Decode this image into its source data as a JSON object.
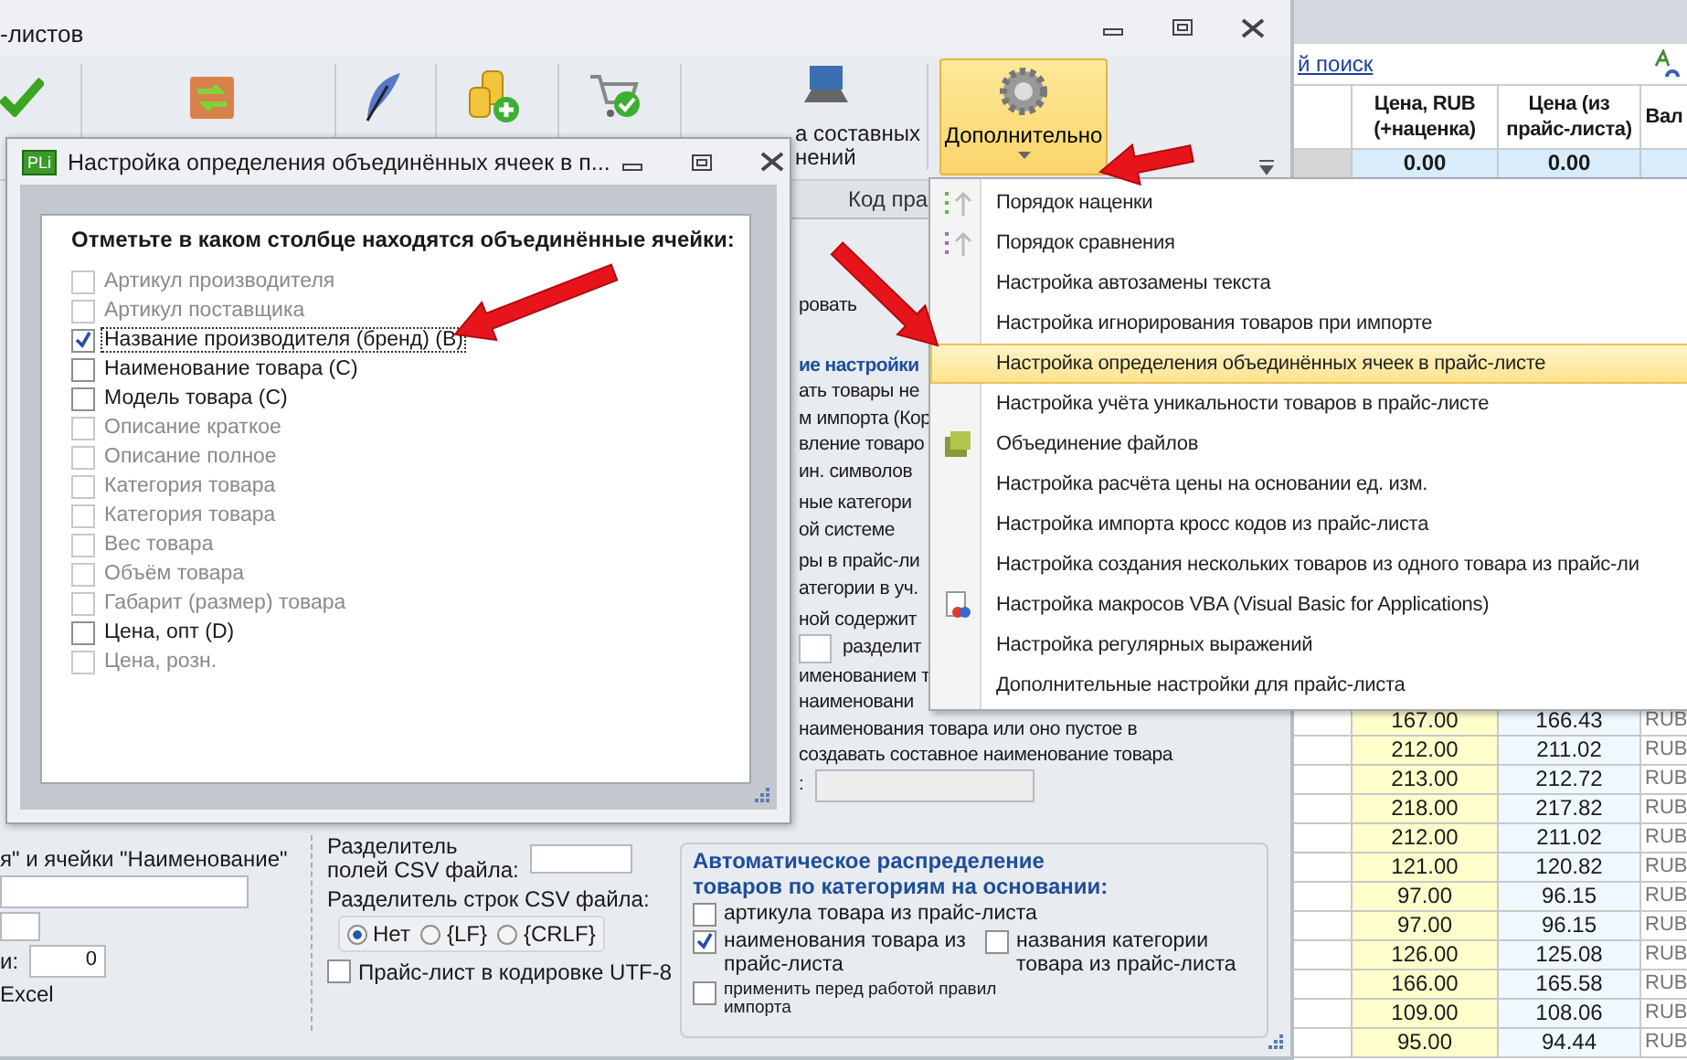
{
  "main_window": {
    "title": "-листов",
    "toolbar": {
      "laptop_label": [
        "а составных",
        "нений"
      ],
      "more_button": {
        "label": "Дополнительно",
        "selected": true
      }
    },
    "column_header": "Код пра",
    "fragments": [
      {
        "kind": "text",
        "text": "ровать"
      },
      {
        "kind": "heading",
        "text": "ие настройки"
      },
      {
        "kind": "text",
        "text": "ать товары не"
      },
      {
        "kind": "text",
        "text": "м импорта (Кор"
      },
      {
        "kind": "text",
        "text": "вление товаро"
      },
      {
        "kind": "text",
        "text": "ин. символов"
      },
      {
        "kind": "gap-text",
        "text": "ные категори"
      },
      {
        "kind": "text",
        "text": "ой системе"
      },
      {
        "kind": "gap-text",
        "text": "ры в прайс-ли"
      },
      {
        "kind": "text",
        "text": "атегории в уч."
      },
      {
        "kind": "gap-text",
        "text": "ной содержит"
      },
      {
        "kind": "field-text",
        "text": "разделит"
      },
      {
        "kind": "text",
        "text": "именованием т"
      },
      {
        "kind": "text",
        "text": "наименовани"
      },
      {
        "kind": "text",
        "text": "наименования товара или оно пустое в"
      },
      {
        "kind": "text",
        "text": "создавать составное наименование товара"
      },
      {
        "kind": "text-field",
        "text": ":"
      }
    ],
    "bottom_left": {
      "caption": "я\" и ячейки \"Наименование\"",
      "count_label": "и:",
      "count_value": "0",
      "excel_label": "Excel"
    },
    "csv": {
      "field_separator_label": [
        "Разделитель",
        "полей CSV файла:"
      ],
      "row_separator_label": "Разделитель строк CSV файла:",
      "radios": [
        {
          "label": "Нет",
          "selected": true
        },
        {
          "label": "{LF}",
          "selected": false
        },
        {
          "label": "{CRLF}",
          "selected": false
        }
      ],
      "utf8": {
        "label": "Прайс-лист в кодировке UTF-8",
        "checked": false
      }
    },
    "category_group": {
      "title": [
        "Автоматическое распределение",
        "товаров по категориям на основании:"
      ],
      "options": [
        {
          "kind": "wide",
          "label": "артикула товара из прайс-листа",
          "checked": false
        },
        {
          "kind": "half",
          "label": "наименования товара из прайс-листа",
          "checked": true
        },
        {
          "kind": "half",
          "label": "названия  категории товара из прайс-листа",
          "checked": false
        },
        {
          "kind": "small",
          "label": "применить перед работой правил импорта",
          "checked": false
        }
      ]
    }
  },
  "grid": {
    "search_link": "й поиск",
    "columns": [
      "Цена, RUB (+наценка)",
      "Цена (из прайс-листа)",
      "Вал"
    ],
    "first_row": [
      "0.00",
      "0.00"
    ],
    "rows": [
      [
        "167.00",
        "166.43",
        "RUB"
      ],
      [
        "212.00",
        "211.02",
        "RUB"
      ],
      [
        "213.00",
        "212.72",
        "RUB"
      ],
      [
        "218.00",
        "217.82",
        "RUB"
      ],
      [
        "212.00",
        "211.02",
        "RUB"
      ],
      [
        "121.00",
        "120.82",
        "RUB"
      ],
      [
        "97.00",
        "96.15",
        "RUB"
      ],
      [
        "97.00",
        "96.15",
        "RUB"
      ],
      [
        "126.00",
        "125.08",
        "RUB"
      ],
      [
        "166.00",
        "165.58",
        "RUB"
      ],
      [
        "109.00",
        "108.06",
        "RUB"
      ],
      [
        "95.00",
        "94.44",
        "RUB"
      ]
    ]
  },
  "menu": {
    "items": [
      {
        "kind": "ranking",
        "label": "Порядок наценки",
        "selected": false
      },
      {
        "kind": "comparison",
        "label": "Порядок сравнения",
        "selected": false
      },
      {
        "kind": "plain",
        "label": "Настройка автозамены текста",
        "selected": false
      },
      {
        "kind": "plain",
        "label": "Настройка игнорирования товаров при импорте",
        "selected": false
      },
      {
        "kind": "plain",
        "label": "Настройка определения объединённых ячеек в прайс-листе",
        "selected": true
      },
      {
        "kind": "plain",
        "label": "Настройка учёта уникальности товаров в прайс-листе",
        "selected": false
      },
      {
        "kind": "files",
        "label": "Объединение файлов",
        "selected": false
      },
      {
        "kind": "plain",
        "label": "Настройка расчёта цены на основании ед. изм.",
        "selected": false
      },
      {
        "kind": "plain",
        "label": "Настройка импорта кросс кодов из прайс-листа",
        "selected": false
      },
      {
        "kind": "plain",
        "label": "Настройка создания нескольких товаров из одного товара из прайс-ли",
        "selected": false
      },
      {
        "kind": "macro",
        "label": "Настройка макросов VBA (Visual Basic for Applications)",
        "selected": false
      },
      {
        "kind": "plain",
        "label": "Настройка регулярных выражений",
        "selected": false
      },
      {
        "kind": "plain",
        "label": "Дополнительные настройки для прайс-листа",
        "selected": false
      }
    ]
  },
  "dialog": {
    "title": "Настройка определения объединённых ячеек в п...",
    "app_badge": "PLi",
    "heading": "Отметьте в каком столбце находятся объединённые ячейки:",
    "items": [
      {
        "label": "Артикул производителя",
        "checked": false,
        "disabled": true,
        "focused": false
      },
      {
        "label": "Артикул поставщика",
        "checked": false,
        "disabled": true,
        "focused": false
      },
      {
        "label": "Название производителя (бренд) (B)",
        "checked": true,
        "disabled": false,
        "focused": true
      },
      {
        "label": "Наименование товара (C)",
        "checked": false,
        "disabled": false,
        "focused": false
      },
      {
        "label": "Модель товара (C)",
        "checked": false,
        "disabled": false,
        "focused": false
      },
      {
        "label": "Описание краткое",
        "checked": false,
        "disabled": true,
        "focused": false
      },
      {
        "label": "Описание полное",
        "checked": false,
        "disabled": true,
        "focused": false
      },
      {
        "label": "Категория товара",
        "checked": false,
        "disabled": true,
        "focused": false
      },
      {
        "label": "Категория товара",
        "checked": false,
        "disabled": true,
        "focused": false
      },
      {
        "label": "Вес товара",
        "checked": false,
        "disabled": true,
        "focused": false
      },
      {
        "label": "Объём товара",
        "checked": false,
        "disabled": true,
        "focused": false
      },
      {
        "label": "Габарит (размер) товара",
        "checked": false,
        "disabled": true,
        "focused": false
      },
      {
        "label": "Цена, опт (D)",
        "checked": false,
        "disabled": false,
        "focused": false
      },
      {
        "label": "Цена, розн.",
        "checked": false,
        "disabled": true,
        "focused": false
      }
    ]
  }
}
